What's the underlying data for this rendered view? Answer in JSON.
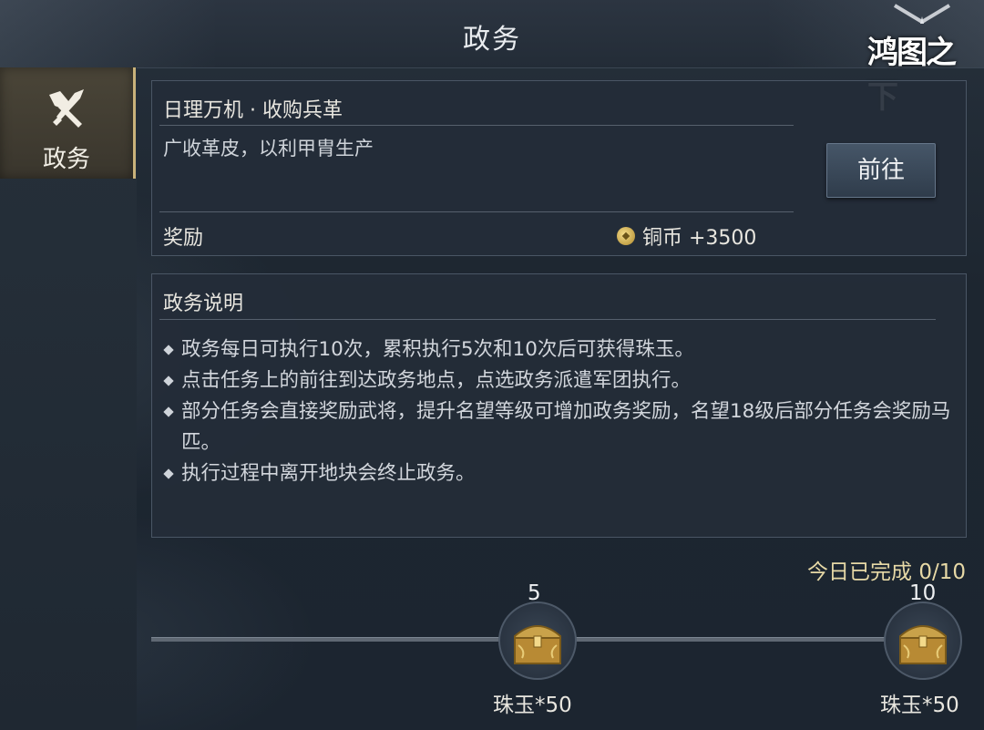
{
  "header": {
    "title": "政务",
    "logo_text": "鸿图之下"
  },
  "sidebar": {
    "items": [
      {
        "label": "政务",
        "icon": "brush-quill-icon"
      }
    ]
  },
  "task": {
    "title": "日理万机 · 收购兵革",
    "description": "广收革皮，以利甲胄生产",
    "reward_label": "奖励",
    "reward_value": "铜币 +3500",
    "go_button": "前往"
  },
  "info": {
    "title": "政务说明",
    "rules": [
      "政务每日可执行10次，累积执行5次和10次后可获得珠玉。",
      "点击任务上的前往到达政务地点，点选政务派遣军团执行。",
      "部分任务会直接奖励武将，提升名望等级可增加政务奖励，名望18级后部分任务会奖励马匹。",
      "执行过程中离开地块会终止政务。"
    ]
  },
  "progress": {
    "text": "今日已完成 0/10",
    "completed": 0,
    "total": 10,
    "milestones": [
      {
        "count": "5",
        "reward": "珠玉*50"
      },
      {
        "count": "10",
        "reward": "珠玉*50"
      }
    ]
  },
  "colors": {
    "accent_gold": "#c9b27a",
    "panel_bg": "#242d38",
    "progress_text": "#e7d9a6"
  }
}
